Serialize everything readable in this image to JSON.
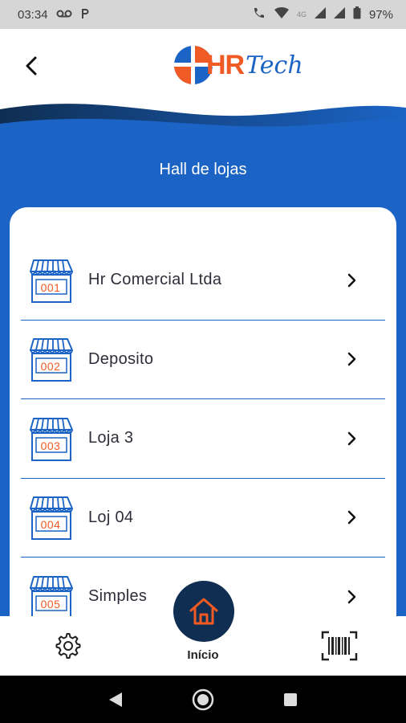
{
  "status_bar": {
    "time": "03:34",
    "left_icons": [
      "voicemail-icon",
      "p-icon"
    ],
    "network_label": "4G",
    "battery": "97%"
  },
  "header": {
    "logo_hr": "HR",
    "logo_tech": "Tech"
  },
  "page": {
    "title": "Hall de lojas"
  },
  "stores": [
    {
      "code": "001",
      "name": "Hr Comercial Ltda"
    },
    {
      "code": "002",
      "name": "Deposito"
    },
    {
      "code": "003",
      "name": "Loja 3"
    },
    {
      "code": "004",
      "name": "Loj 04"
    },
    {
      "code": "005",
      "name": "Simples"
    }
  ],
  "bottom_nav": {
    "home_label": "Início"
  },
  "colors": {
    "primary": "#1b63c4",
    "accent": "#f05a24",
    "dark": "#0f2e52"
  }
}
